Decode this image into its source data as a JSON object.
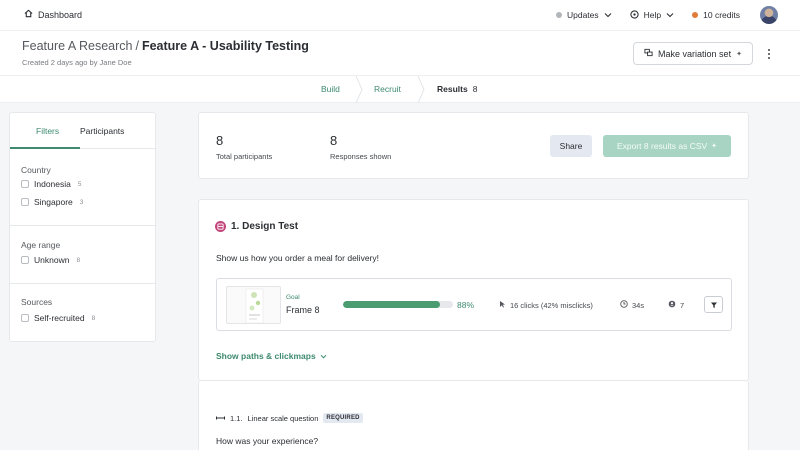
{
  "topbar": {
    "home_label": "Dashboard",
    "updates_label": "Updates",
    "help_label": "Help",
    "credits_label": "10 credits",
    "colors": {
      "updates_dot": "#b3b6ba",
      "credits_dot": "#e07b39"
    }
  },
  "header": {
    "project": "Feature A Research",
    "separator": "/",
    "study": "Feature A - Usability Testing",
    "subtitle": "Created 2 days ago by Jane Doe",
    "variation_button": "Make variation set"
  },
  "steps": {
    "items": [
      {
        "label": "Build"
      },
      {
        "label": "Recruit"
      },
      {
        "label": "Results",
        "count": "8"
      }
    ]
  },
  "sidebar": {
    "tabs": [
      "Filters",
      "Participants"
    ],
    "groups": [
      {
        "title": "Country",
        "options": [
          {
            "label": "Indonesia",
            "count": "5"
          },
          {
            "label": "Singapore",
            "count": "3"
          }
        ]
      },
      {
        "title": "Age range",
        "options": [
          {
            "label": "Unknown",
            "count": "8"
          }
        ]
      },
      {
        "title": "Sources",
        "options": [
          {
            "label": "Self-recruited",
            "count": "8"
          }
        ]
      }
    ]
  },
  "summary": {
    "total_value": "8",
    "total_label": "Total participants",
    "shown_value": "8",
    "shown_label": "Responses shown",
    "share_label": "Share",
    "export_label": "Export 8 results as CSV"
  },
  "design_test": {
    "title": "1. Design Test",
    "prompt": "Show us how you order a meal for delivery!",
    "frame": {
      "goal_label": "Goal",
      "name": "Frame 8",
      "success_fraction": 0.88,
      "success_label": "88%",
      "clicks_label": "16 clicks (42% misclicks)",
      "time_label": "34s",
      "participants_label": "7"
    },
    "paths_link": "Show paths & clickmaps"
  },
  "question": {
    "number": "1.1.",
    "type": "Linear scale question",
    "required_label": "REQUIRED",
    "text": "How was your experience?"
  },
  "colors": {
    "accent": "#3d8a6e",
    "bar": "#4b9c71",
    "badge": "#c2457c",
    "export_disabled": "#a8d4c4"
  }
}
